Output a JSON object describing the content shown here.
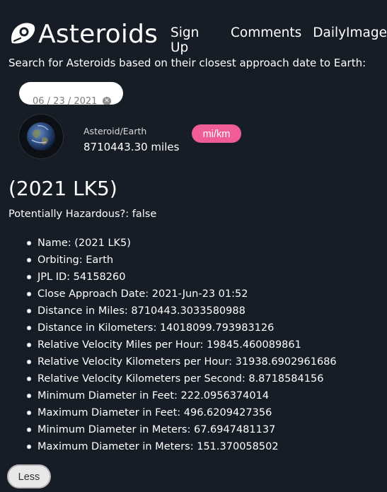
{
  "header": {
    "brand": "Asteroids",
    "nav": [
      "Sign Up",
      "Comments",
      "DailyImage"
    ]
  },
  "search": {
    "tagline": "Search for Asteroids based on their closest approach date to Earth:",
    "date_value": "06 / 23 / 2021"
  },
  "distance": {
    "label": "Asteroid/Earth",
    "value": "8710443.30 miles",
    "unit_toggle": "mi/km"
  },
  "asteroid": {
    "title": "(2021 LK5)",
    "hazard": "Potentially Hazardous?: false",
    "details": [
      "Name: (2021 LK5)",
      "Orbiting: Earth",
      "JPL ID: 54158260",
      "Close Approach Date: 2021-Jun-23 01:52",
      "Distance in Miles: 8710443.3033580988",
      "Distance in Kilometers: 14018099.793983126",
      "Relative Velocity Miles per Hour: 19845.460089861",
      "Relative Velocity Kilometers per Hour: 31938.6902961686",
      "Relative Velocity Kilometers per Second: 8.8718584156",
      "Minimum Diameter in Feet: 222.0956374014",
      "Maximum Diameter in Feet: 496.6209427356",
      "Minimum Diameter in Meters: 67.6947481137",
      "Maximum Diameter in Meters: 151.370058502"
    ],
    "less_label": "Less"
  },
  "colors": {
    "background": "#161d26",
    "accent_pink": "#f05d96"
  },
  "icons": {
    "logo": "asteroid-logo-icon",
    "planet": "earth-icon",
    "clear": "clear-icon"
  }
}
